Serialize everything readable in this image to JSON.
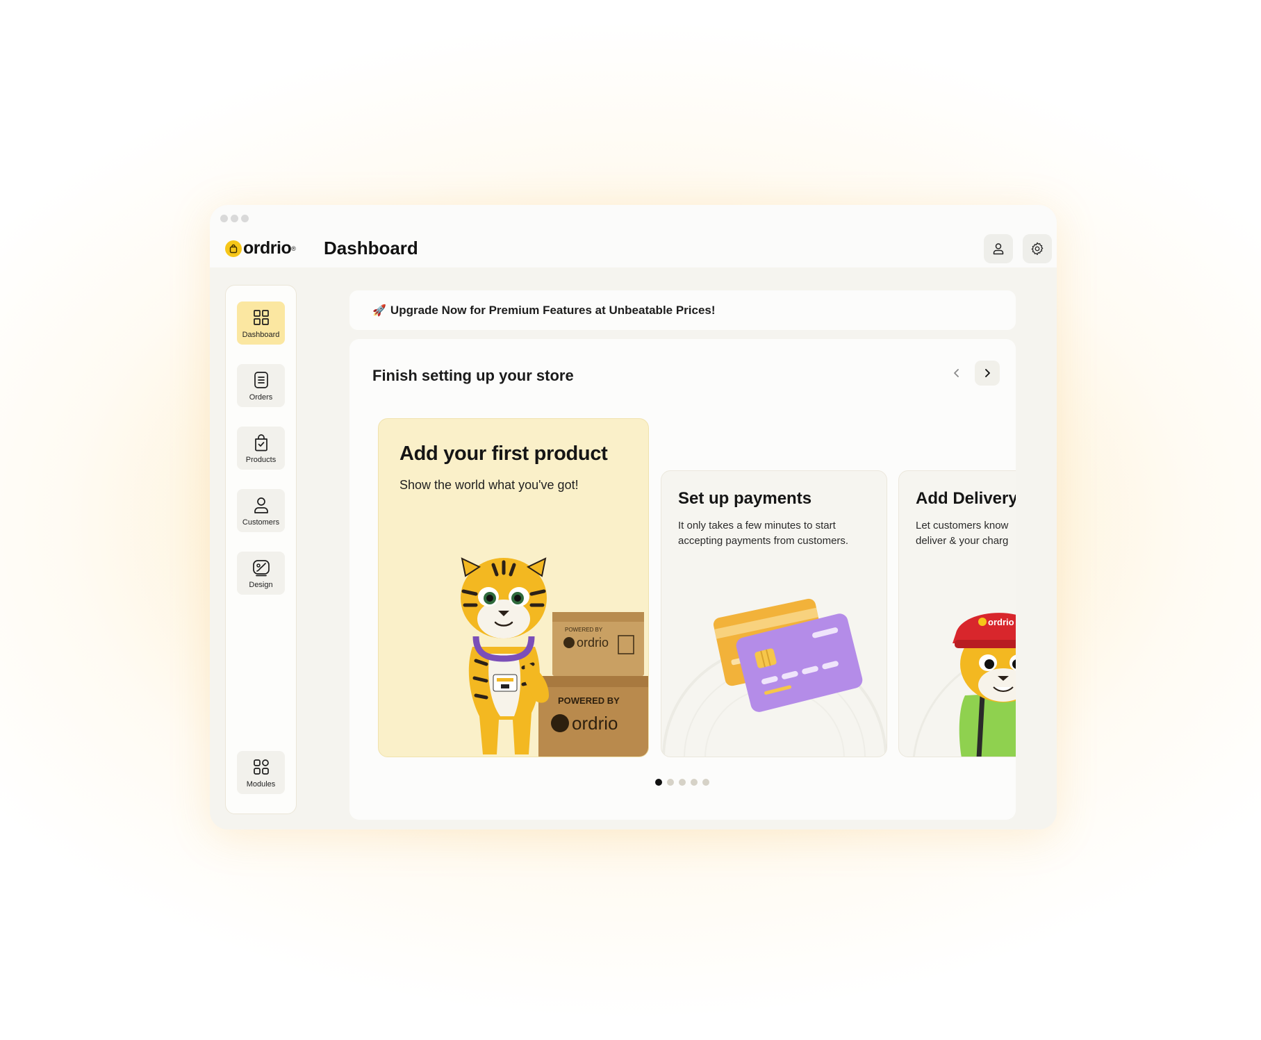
{
  "app": {
    "logo_text": "ordrio",
    "logo_mark": "®",
    "page_title": "Dashboard"
  },
  "header": {
    "actions": [
      {
        "icon": "user-icon"
      },
      {
        "icon": "gear-icon"
      }
    ]
  },
  "sidebar": {
    "items": [
      {
        "label": "Dashboard",
        "icon": "grid-icon",
        "active": true
      },
      {
        "label": "Orders",
        "icon": "document-icon",
        "active": false
      },
      {
        "label": "Products",
        "icon": "shopping-bag-icon",
        "active": false
      },
      {
        "label": "Customers",
        "icon": "user-icon",
        "active": false
      },
      {
        "label": "Design",
        "icon": "palette-icon",
        "active": false
      }
    ],
    "bottom_item": {
      "label": "Modules",
      "icon": "modules-icon"
    }
  },
  "banner": {
    "icon": "rocket-icon",
    "emoji": "🚀",
    "text": "Upgrade Now for Premium Features at Unbeatable Prices!"
  },
  "setup": {
    "title": "Finish setting up your store",
    "cards": [
      {
        "title": "Add your first product",
        "description": "Show the world what you've got!",
        "illustration": "tiger-mascot-with-boxes",
        "box_text_small": "POWERED BY",
        "box_brand": "ordrio"
      },
      {
        "title": "Set up payments",
        "description": "It only takes a few minutes to start accepting payments from customers.",
        "illustration": "credit-cards"
      },
      {
        "title": "Add Delivery",
        "description": "Let customers know\ndeliver & your charg",
        "illustration": "tiger-delivery-mascot",
        "cap_text": "ordrio"
      }
    ],
    "pagination": {
      "count": 5,
      "active_index": 0
    }
  },
  "colors": {
    "accent_yellow": "#f6c619",
    "active_nav_bg": "#fbe7a1",
    "card_highlight_bg": "#faf0c9",
    "card_purple": "#b48ce8",
    "card_orange": "#f2b23a"
  }
}
